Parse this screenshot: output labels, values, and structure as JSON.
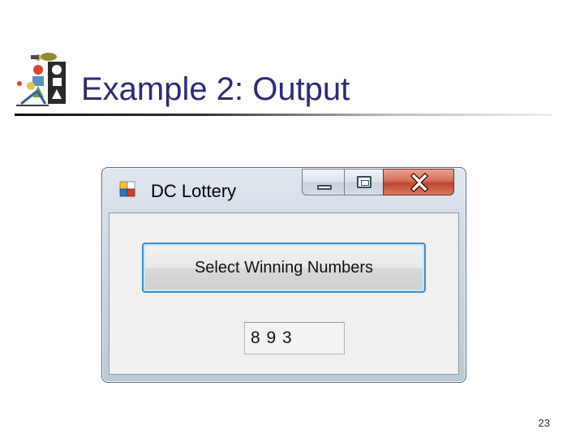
{
  "slide": {
    "title": "Example 2: Output",
    "page_number": "23",
    "logo_icon": "shapes-figure-icon"
  },
  "window": {
    "title": "DC Lottery",
    "app_icon": "windows-form-icon",
    "caption_buttons": {
      "minimize": "minimize-icon",
      "maximize": "maximize-icon",
      "close": "close-icon"
    },
    "button_label": "Select Winning Numbers",
    "result_value": "8  9  3"
  },
  "colors": {
    "title_text": "#2e2a7a",
    "close_button": "#c0432b",
    "button_focus": "#3c8fcf",
    "client_background": "#f0f0f0"
  }
}
